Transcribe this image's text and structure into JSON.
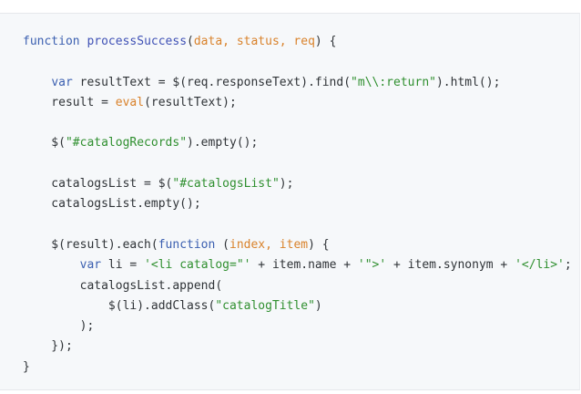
{
  "code": {
    "lines": [
      [
        {
          "t": "function",
          "c": "keyword"
        },
        {
          "t": " ",
          "c": "plain"
        },
        {
          "t": "processSuccess",
          "c": "name"
        },
        {
          "t": "(",
          "c": "plain"
        },
        {
          "t": "data, status, req",
          "c": "param"
        },
        {
          "t": ") {",
          "c": "plain"
        }
      ],
      [],
      [
        {
          "t": "    ",
          "c": "plain"
        },
        {
          "t": "var",
          "c": "keyword"
        },
        {
          "t": " resultText = $(req.responseText).find(",
          "c": "plain"
        },
        {
          "t": "\"m\\\\:return\"",
          "c": "string"
        },
        {
          "t": ").html();",
          "c": "plain"
        }
      ],
      [
        {
          "t": "    result = ",
          "c": "plain"
        },
        {
          "t": "eval",
          "c": "builtin"
        },
        {
          "t": "(resultText);",
          "c": "plain"
        }
      ],
      [],
      [
        {
          "t": "    $(",
          "c": "plain"
        },
        {
          "t": "\"#catalogRecords\"",
          "c": "string"
        },
        {
          "t": ").empty();",
          "c": "plain"
        }
      ],
      [],
      [
        {
          "t": "    catalogsList = $(",
          "c": "plain"
        },
        {
          "t": "\"#catalogsList\"",
          "c": "string"
        },
        {
          "t": ");",
          "c": "plain"
        }
      ],
      [
        {
          "t": "    catalogsList.empty();",
          "c": "plain"
        }
      ],
      [],
      [
        {
          "t": "    $(result).each(",
          "c": "plain"
        },
        {
          "t": "function",
          "c": "keyword"
        },
        {
          "t": " (",
          "c": "plain"
        },
        {
          "t": "index, item",
          "c": "param"
        },
        {
          "t": ") {",
          "c": "plain"
        }
      ],
      [
        {
          "t": "        ",
          "c": "plain"
        },
        {
          "t": "var",
          "c": "keyword"
        },
        {
          "t": " li = ",
          "c": "plain"
        },
        {
          "t": "'<li catalog=\"'",
          "c": "string"
        },
        {
          "t": " + item.name + ",
          "c": "plain"
        },
        {
          "t": "'\">'",
          "c": "string"
        },
        {
          "t": " + item.synonym + ",
          "c": "plain"
        },
        {
          "t": "'</li>'",
          "c": "string"
        },
        {
          "t": ";",
          "c": "plain"
        }
      ],
      [
        {
          "t": "        catalogsList.append(",
          "c": "plain"
        }
      ],
      [
        {
          "t": "            $(li).addClass(",
          "c": "plain"
        },
        {
          "t": "\"catalogTitle\"",
          "c": "string"
        },
        {
          "t": ")",
          "c": "plain"
        }
      ],
      [
        {
          "t": "        );",
          "c": "plain"
        }
      ],
      [
        {
          "t": "    });",
          "c": "plain"
        }
      ],
      [
        {
          "t": "}",
          "c": "plain"
        }
      ]
    ]
  },
  "colors": {
    "background": "#f6f8fa",
    "keyword": "#3b5fb0",
    "function_name": "#3f51b5",
    "param": "#d9822b",
    "string": "#2f8f2f",
    "plain": "#2f3337"
  }
}
